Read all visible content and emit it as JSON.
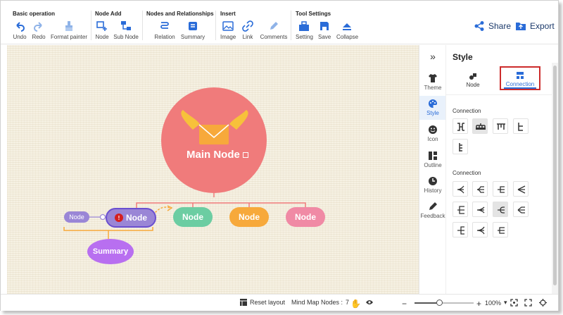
{
  "toolbar": {
    "groups": [
      {
        "title": "Basic operation",
        "tools": [
          "Undo",
          "Redo",
          "Format painter"
        ]
      },
      {
        "title": "Node Add",
        "tools": [
          "Node",
          "Sub Node"
        ]
      },
      {
        "title": "Nodes and Relationships",
        "tools": [
          "Relation",
          "Summary"
        ]
      },
      {
        "title": "Insert",
        "tools": [
          "Image",
          "Link",
          "Comments"
        ]
      },
      {
        "title": "Tool Settings",
        "tools": [
          "Setting",
          "Save",
          "Collapse"
        ]
      }
    ],
    "share_label": "Share",
    "export_label": "Export",
    "accent": "#2a6cd8"
  },
  "canvas": {
    "main_node": "Main Node",
    "nodes": [
      "Node",
      "Node",
      "Node",
      "Node"
    ],
    "side_node": "Node",
    "summary": "Summary",
    "badge": "!",
    "colors": {
      "main": "#f07b7b",
      "selected": "#9a86d6",
      "green": "#6ccda2",
      "orange": "#f7a93b",
      "pink": "#f08aa5",
      "side": "#9a86d6",
      "summary": "#b86ff0"
    }
  },
  "icon_column": {
    "items": [
      "Theme",
      "Style",
      "Icon",
      "Outline",
      "History",
      "Feedback"
    ],
    "active": "Style"
  },
  "panel": {
    "title": "Style",
    "tabs": [
      "Node",
      "Connection"
    ],
    "active_tab": "Connection",
    "section1": "Connection",
    "section2": "Connection"
  },
  "statusbar": {
    "reset_layout": "Reset layout",
    "nodes_label": "Mind Map Nodes :",
    "nodes_count": "7",
    "zoom_minus": "−",
    "zoom_plus": "+",
    "zoom_value": "100%",
    "zoom_chevron": "▾",
    "zoom_fraction": 0.42
  }
}
